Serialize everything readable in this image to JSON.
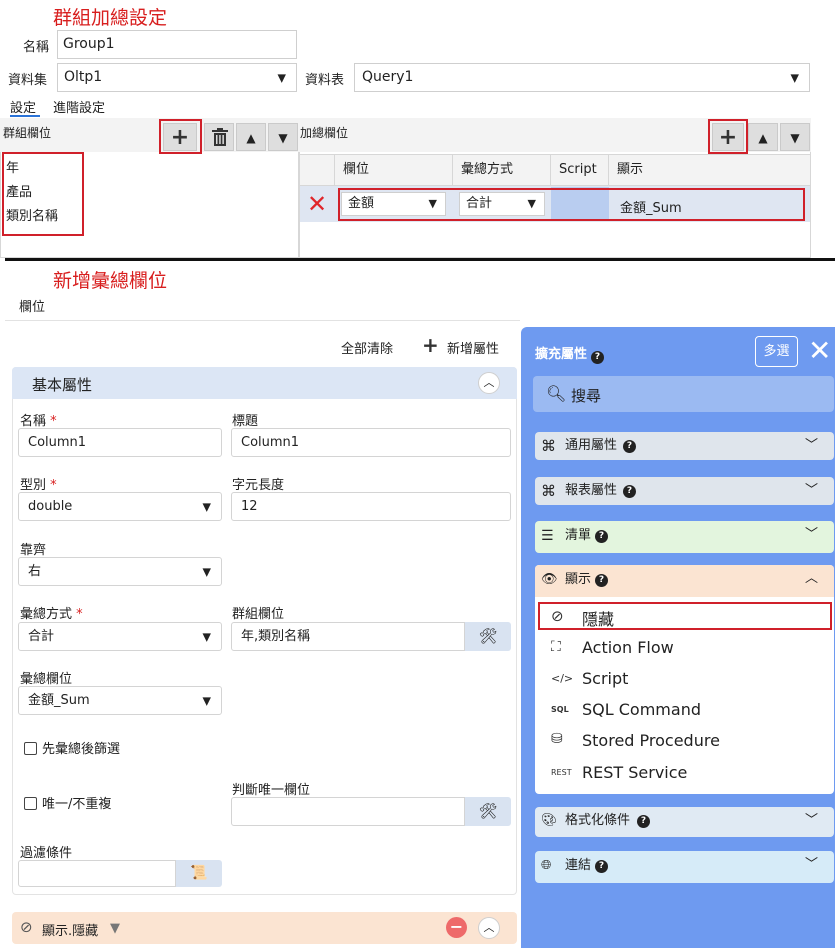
{
  "group_settings": {
    "title": "群組加總設定",
    "name_label": "名稱",
    "name_value": "Group1",
    "dataset_label": "資料集",
    "dataset_value": "Oltp1",
    "table_label": "資料表",
    "table_value": "Query1",
    "tabs": [
      "設定",
      "進階設定"
    ],
    "group_fields_label": "群組欄位",
    "group_fields": [
      "年",
      "產品",
      "類別名稱"
    ],
    "sum_fields_label": "加總欄位",
    "grid_headers": [
      "欄位",
      "彙總方式",
      "Script",
      "顯示"
    ],
    "grid_row": {
      "field": "金額",
      "method": "合計",
      "script": "",
      "display": "金額_Sum"
    }
  },
  "new_summary": {
    "title": "新增彙總欄位",
    "tab_label": "欄位",
    "clear_all": "全部清除",
    "add_prop": "新增屬性",
    "basic_section": "基本屬性",
    "name_label": "名稱",
    "name_value": "Column1",
    "caption_label": "標題",
    "caption_value": "Column1",
    "type_label": "型別",
    "type_value": "double",
    "length_label": "字元長度",
    "length_value": "12",
    "align_label": "靠齊",
    "align_value": "右",
    "method_label": "彙總方式",
    "method_value": "合計",
    "group_field_label": "群組欄位",
    "group_field_value": "年,類別名稱",
    "sum_field_label": "彙總欄位",
    "sum_field_value": "金額_Sum",
    "filter_first_label": "先彙總後篩選",
    "unique_label": "唯一/不重複",
    "unique_field_label": "判斷唯一欄位",
    "filter_label": "過濾條件",
    "bottom_bar_label": "顯示.隱藏"
  },
  "ext_panel": {
    "title": "擴充屬性",
    "multi_select": "多選",
    "search_placeholder": "搜尋",
    "groups": [
      {
        "label": "通用屬性"
      },
      {
        "label": "報表屬性"
      },
      {
        "label": "清單"
      },
      {
        "label": "顯示"
      },
      {
        "label": "格式化條件"
      },
      {
        "label": "連結"
      }
    ],
    "display_items": [
      {
        "label": "隱藏",
        "icon": "eye-slash-icon"
      },
      {
        "label": "Action Flow",
        "icon": "flow-icon"
      },
      {
        "label": "Script",
        "icon": "code-icon"
      },
      {
        "label": "SQL Command",
        "icon": "sql-icon"
      },
      {
        "label": "Stored Procedure",
        "icon": "database-icon"
      },
      {
        "label": "REST Service",
        "icon": "rest-icon"
      }
    ],
    "colors": {
      "panel": "#6e9af0",
      "group_default": "#dfe5ec",
      "list_group": "#e3f5de",
      "display_group": "#fbe4d2",
      "format_group": "#e0eaf3",
      "link_group": "#d6ebf8"
    }
  }
}
